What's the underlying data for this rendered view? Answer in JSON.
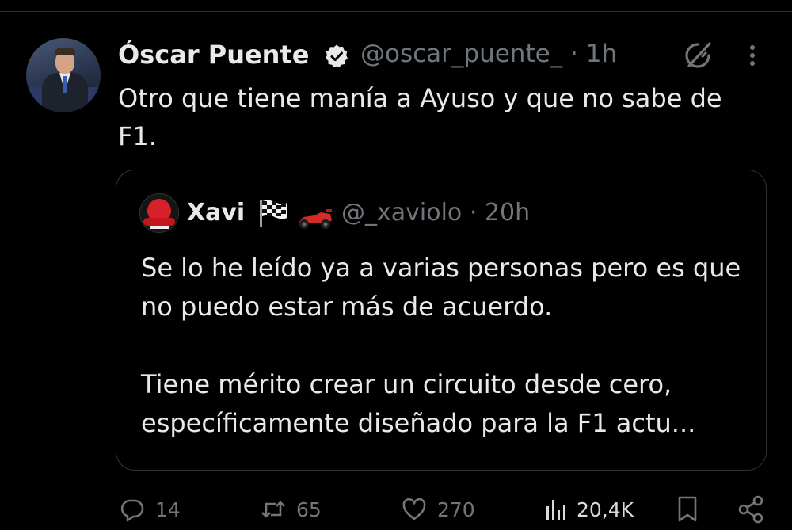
{
  "tweet": {
    "author_name": "Óscar Puente",
    "handle": "@oscar_puente_",
    "separator": "·",
    "time": "1h",
    "text": "Otro que tiene manía a Ayuso y que no sabe de F1."
  },
  "quote": {
    "author_name": "Xavi",
    "handle": "@_xaviolo",
    "separator": "·",
    "time": "20h",
    "paragraph_1": "Se lo he leído ya a varias personas pero es que no puedo estar más de acuerdo.",
    "paragraph_2": "Tiene mérito crear un circuito desde cero, específicamente diseñado para la F1 actu..."
  },
  "actions": {
    "replies": "14",
    "reposts": "65",
    "likes": "270",
    "views": "20,4K"
  },
  "icons": {
    "verified": "verified-badge-icon",
    "grok": "grok-icon",
    "more": "more-options-icon",
    "flag": "checkered-flag-icon",
    "car": "race-car-icon",
    "reply": "reply-icon",
    "retweet": "retweet-icon",
    "like": "heart-icon",
    "views": "views-chart-icon",
    "bookmark": "bookmark-icon",
    "share": "share-icon"
  },
  "colors": {
    "background": "#000000",
    "text": "#e7e9ea",
    "muted": "#71767b",
    "border": "#2f3336",
    "verified": "#ffffff"
  }
}
